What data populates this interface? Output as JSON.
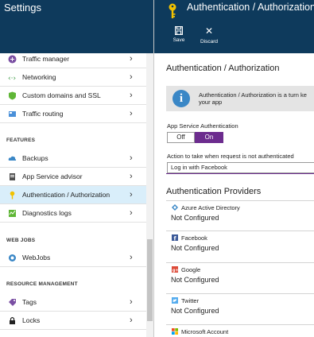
{
  "left": {
    "title": "Settings",
    "items_top": [
      {
        "label": "Traffic manager",
        "icon": "traffic-manager-icon"
      },
      {
        "label": "Networking",
        "icon": "networking-icon"
      },
      {
        "label": "Custom domains and SSL",
        "icon": "shield-icon"
      },
      {
        "label": "Traffic routing",
        "icon": "traffic-routing-icon"
      }
    ],
    "section_features": "FEATURES",
    "items_features": [
      {
        "label": "Backups",
        "icon": "cloud-icon"
      },
      {
        "label": "App Service advisor",
        "icon": "advisor-icon"
      },
      {
        "label": "Authentication / Authorization",
        "icon": "key-icon"
      },
      {
        "label": "Diagnostics logs",
        "icon": "diagnostics-icon"
      }
    ],
    "section_webjobs": "WEB JOBS",
    "items_webjobs": [
      {
        "label": "WebJobs",
        "icon": "webjobs-icon"
      }
    ],
    "section_resource": "RESOURCE MANAGEMENT",
    "items_resource": [
      {
        "label": "Tags",
        "icon": "tag-icon"
      },
      {
        "label": "Locks",
        "icon": "lock-icon"
      }
    ]
  },
  "right": {
    "title": "Authentication / Authorization",
    "toolbar": {
      "save_label": "Save",
      "discard_label": "Discard"
    },
    "heading": "Authentication / Authorization",
    "info_text": "Authentication / Authorization is a turn ke",
    "info_text2": "your app",
    "app_service_auth_label": "App Service Authentication",
    "toggle_off": "Off",
    "toggle_on": "On",
    "action_label": "Action to take when request is not authenticated",
    "action_value": "Log in with Facebook",
    "providers_heading": "Authentication Providers",
    "providers": [
      {
        "name": "Azure Active Directory",
        "status": "Not Configured",
        "icon": "azure-ad-icon"
      },
      {
        "name": "Facebook",
        "status": "Not Configured",
        "icon": "facebook-icon"
      },
      {
        "name": "Google",
        "status": "Not Configured",
        "icon": "google-icon"
      },
      {
        "name": "Twitter",
        "status": "Not Configured",
        "icon": "twitter-icon"
      },
      {
        "name": "Microsoft Account",
        "status": "",
        "icon": "microsoft-icon"
      }
    ]
  },
  "colors": {
    "header": "#0e3a5c",
    "accent": "#6c2c8e",
    "active_item": "#d9eefa",
    "info_icon": "#3a87c6"
  }
}
